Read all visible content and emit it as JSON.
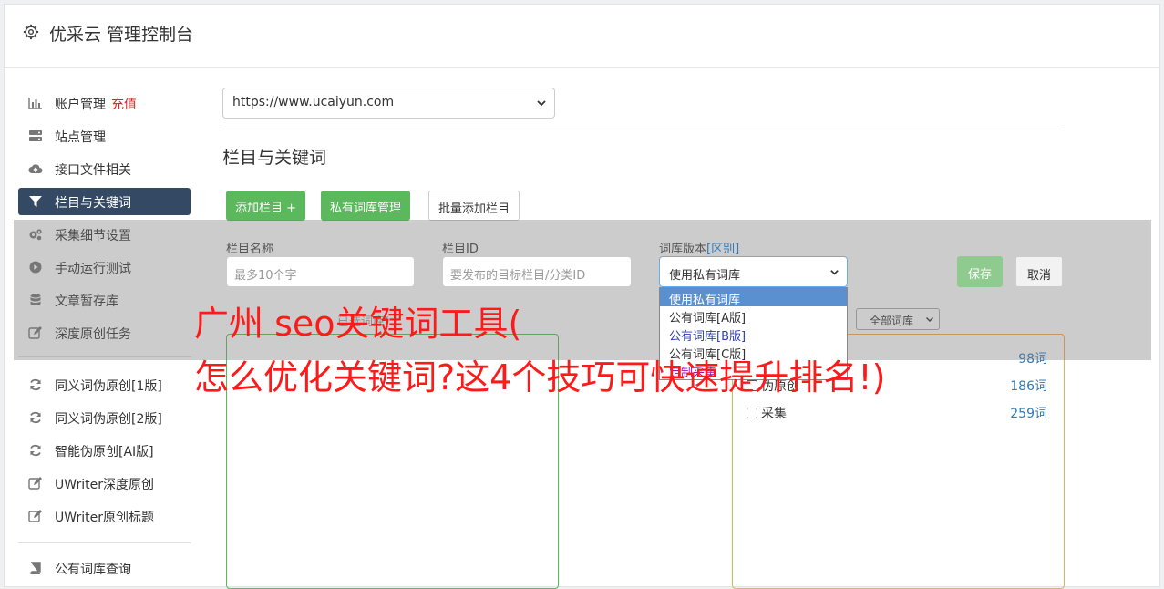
{
  "app": {
    "title": "优采云 管理控制台"
  },
  "sidebar": {
    "items": [
      {
        "label": "账户管理",
        "badge": "充值",
        "icon": "bar-chart-icon"
      },
      {
        "label": "站点管理",
        "icon": "server-icon"
      },
      {
        "label": "接口文件相关",
        "icon": "cloud-upload-icon"
      },
      {
        "label": "栏目与关键词",
        "icon": "filter-icon",
        "active": true
      },
      {
        "label": "采集细节设置",
        "icon": "cogs-icon"
      },
      {
        "label": "手动运行测试",
        "icon": "play-circle-icon"
      },
      {
        "label": "文章暂存库",
        "icon": "database-icon"
      },
      {
        "label": "深度原创任务",
        "icon": "edit-icon"
      },
      {
        "label": "同义词伪原创[1版]",
        "icon": "refresh-icon"
      },
      {
        "label": "同义词伪原创[2版]",
        "icon": "refresh-icon"
      },
      {
        "label": "智能伪原创[AI版]",
        "icon": "refresh-icon"
      },
      {
        "label": "UWriter深度原创",
        "icon": "edit-icon"
      },
      {
        "label": "UWriter原创标题",
        "icon": "edit-icon"
      },
      {
        "label": "公有词库查询",
        "icon": "book-icon"
      }
    ]
  },
  "main": {
    "site_select_value": "https://www.ucaiyun.com",
    "section_title": "栏目与关键词",
    "buttons": {
      "add_column": "添加栏目 +",
      "private_lib": "私有词库管理",
      "batch_add": "批量添加栏目"
    },
    "form": {
      "name_label": "栏目名称",
      "name_placeholder": "最多10个字",
      "id_label": "栏目ID",
      "id_placeholder": "要发布的目标栏目/分类ID",
      "lib_label": "词库版本",
      "lib_diff_link": "[区别]",
      "lib_value": "使用私有词库",
      "save": "保存",
      "cancel": "取消"
    },
    "lib_options": [
      "使用私有词库",
      "公有词库[A版]",
      "公有词库[B版]",
      "公有词库[C版]",
      "定制采集"
    ],
    "selected_label": "已选词库(",
    "all_lib_select": "全部词库",
    "categories": [
      {
        "label": "",
        "count": "98词"
      },
      {
        "label": "伪原创",
        "count": "186词"
      },
      {
        "label": "采集",
        "count": "259词"
      }
    ]
  },
  "watermark": {
    "line1": "广州 seo关键词工具(",
    "line2": "怎么优化关键词?这4个技巧可快速提升排名!)"
  },
  "colors": {
    "active_nav": "#344a64",
    "green": "#5cb85c",
    "link_blue": "#337ab7",
    "watermark_red": "#ff1a1a"
  }
}
